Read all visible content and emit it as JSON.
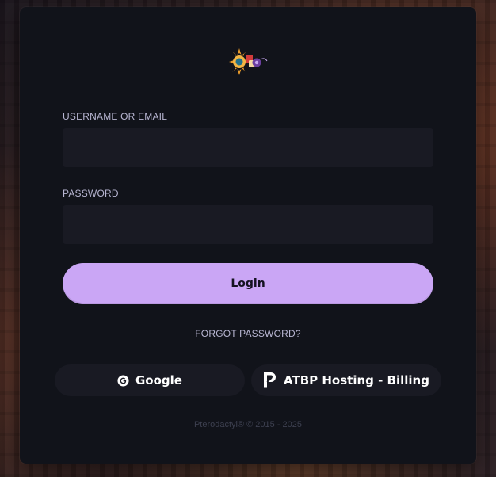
{
  "login": {
    "username_label": "USERNAME OR EMAIL",
    "username_value": "",
    "password_label": "PASSWORD",
    "password_value": "",
    "login_button": "Login",
    "forgot_password": "FORGOT PASSWORD?"
  },
  "sso": {
    "google_label": "Google",
    "google_icon": "google-icon",
    "billing_label": "ATBP Hosting - Billing",
    "billing_icon": "paymenter-icon"
  },
  "footer": {
    "text": "Pterodactyl® © 2015 - 2025"
  },
  "colors": {
    "accent": "#caa6f5",
    "card_bg": "#11131a",
    "input_bg": "#191a23"
  }
}
